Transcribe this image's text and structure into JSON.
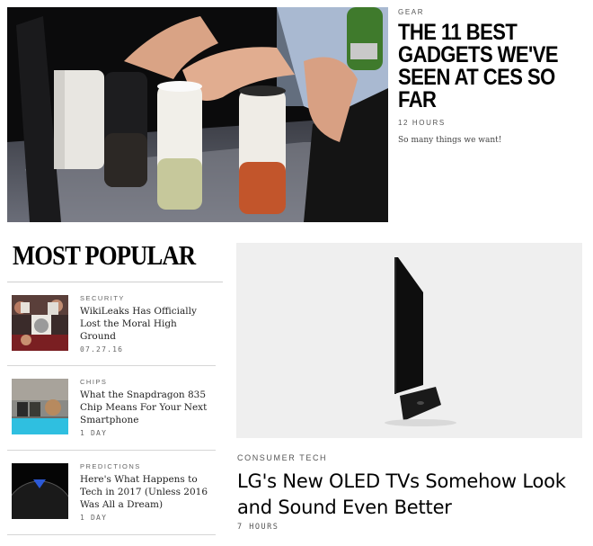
{
  "hero": {
    "category": "GEAR",
    "title": "THE 11 BEST GADGETS WE'VE SEEN AT CES SO FAR",
    "time": "12 HOURS",
    "description": "So many things we want!"
  },
  "most_popular": {
    "heading": "MOST POPULAR",
    "items": [
      {
        "category": "SECURITY",
        "title": "WikiLeaks Has Officially Lost the Moral High Ground",
        "date": "07.27.16"
      },
      {
        "category": "CHIPS",
        "title": "What the Snapdragon 835 Chip Means For Your Next Smartphone",
        "date": "1 DAY"
      },
      {
        "category": "PREDICTIONS",
        "title": "Here's What Happens to Tech in 2017 (Unless 2016 Was All a Dream)",
        "date": "1 DAY"
      }
    ]
  },
  "feature": {
    "category": "CONSUMER TECH",
    "title": "LG's New OLED TVs Somehow Look and Sound Even Better",
    "time": "7 HOURS"
  }
}
